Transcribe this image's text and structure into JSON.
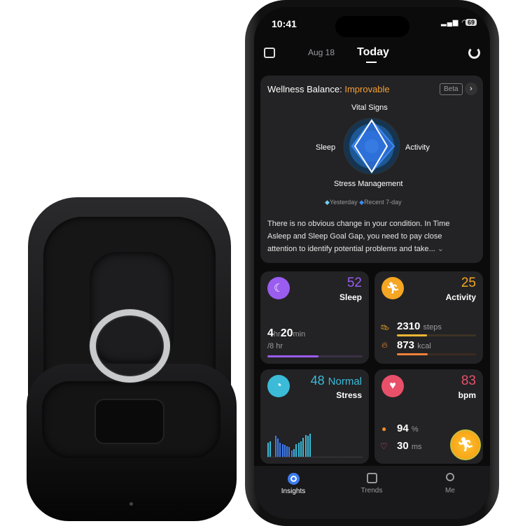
{
  "status": {
    "time": "10:41",
    "battery": "69"
  },
  "header": {
    "prev_date": "Aug 18",
    "current": "Today"
  },
  "wellness": {
    "title": "Wellness Balance:",
    "status": "Improvable",
    "status_color": "#f5a033",
    "badge": "Beta",
    "axes": [
      "Vital Signs",
      "Activity",
      "Stress Management",
      "Sleep"
    ],
    "legend": [
      "Yesterday",
      "Recent 7-day"
    ],
    "summary": "There is no obvious change in your condition. In Time Asleep and Sleep Goal Gap, you need to pay close attention to identify potential problems and take..."
  },
  "sleep": {
    "score": "52",
    "label": "Sleep",
    "hours": "4",
    "hr_unit": "hr",
    "minutes": "20",
    "min_unit": "min",
    "goal": "/8 hr",
    "progress": 0.54,
    "color": "#9b5cf0"
  },
  "activity": {
    "score": "25",
    "label": "Activity",
    "steps": "2310",
    "steps_unit": "steps",
    "steps_progress": 0.38,
    "kcal": "873",
    "kcal_unit": "kcal",
    "kcal_progress": 0.39,
    "color": "#f5a623"
  },
  "stress": {
    "score": "48",
    "level": "Normal",
    "label": "Stress",
    "color": "#3bbbd8",
    "bars": [
      20,
      22,
      30,
      26,
      20,
      18,
      17,
      15,
      14,
      9,
      11,
      18,
      20,
      22,
      27,
      31,
      30,
      33
    ]
  },
  "heart": {
    "value": "83",
    "unit": "bpm",
    "spo2": "94",
    "spo2_unit": "%",
    "hrv": "30",
    "hrv_unit": "ms",
    "color": "#e8506a"
  },
  "tabs": [
    {
      "label": "Insights",
      "active": true
    },
    {
      "label": "Trends"
    },
    {
      "label": "Me"
    }
  ]
}
